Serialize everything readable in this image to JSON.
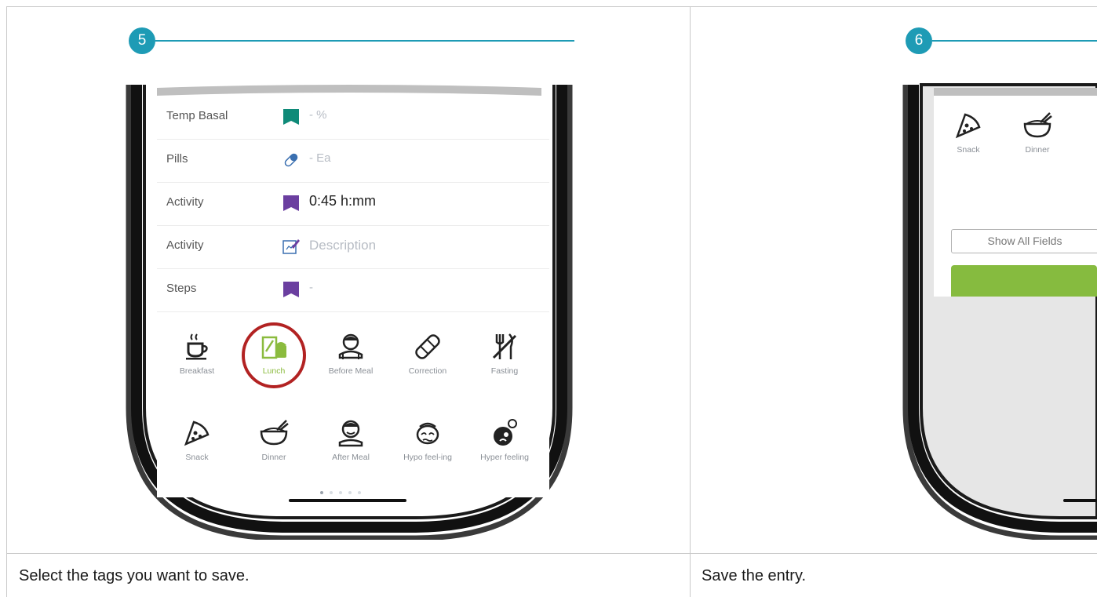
{
  "steps": [
    {
      "number": "5",
      "caption": "Select the tags you want to save."
    },
    {
      "number": "6",
      "caption": "Save the entry."
    }
  ],
  "phone1": {
    "rows": [
      {
        "label": "Temp Basal",
        "icon": "temp-basal-flag-icon",
        "value": "- %"
      },
      {
        "label": "Pills",
        "icon": "pill-icon",
        "value": "- Ea"
      },
      {
        "label": "Activity",
        "icon": "activity-flag-icon",
        "value": "0:45 h:mm"
      },
      {
        "label": "Activity",
        "icon": "edit-note-icon",
        "value": "Description"
      },
      {
        "label": "Steps",
        "icon": "steps-flag-icon",
        "value": "-"
      }
    ],
    "tags": [
      {
        "label": "Breakfast",
        "icon": "coffee-cup-icon"
      },
      {
        "label": "Lunch",
        "icon": "lunch-icon",
        "selected": true
      },
      {
        "label": "Before Meal",
        "icon": "before-meal-icon"
      },
      {
        "label": "Correction",
        "icon": "bandage-icon"
      },
      {
        "label": "Fasting",
        "icon": "fasting-icon"
      },
      {
        "label": "Snack",
        "icon": "pizza-slice-icon"
      },
      {
        "label": "Dinner",
        "icon": "bowl-icon"
      },
      {
        "label": "After Meal",
        "icon": "after-meal-icon"
      },
      {
        "label": "Hypo feel-ing",
        "icon": "hypo-face-icon"
      },
      {
        "label": "Hyper feeling",
        "icon": "hyper-face-icon"
      }
    ]
  },
  "phone2": {
    "tags": [
      {
        "label": "Snack",
        "icon": "pizza-slice-icon"
      },
      {
        "label": "Dinner",
        "icon": "bowl-icon"
      }
    ],
    "show_all_fields": "Show All Fields"
  },
  "colors": {
    "accent": "#1e9bb5",
    "purple": "#6b3fa0",
    "teal": "#0f8a78",
    "green": "#86bb3f",
    "selection_ring": "#b22222"
  }
}
